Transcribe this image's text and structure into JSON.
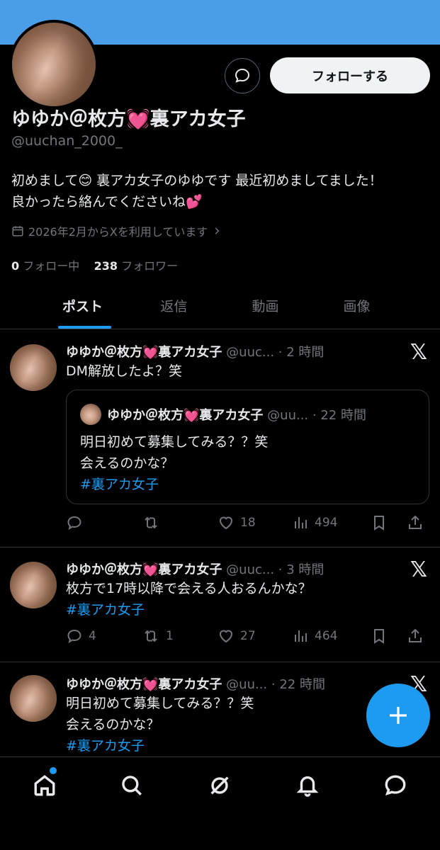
{
  "profile": {
    "display_name": "ゆゆか＠枚方💓裏アカ女子",
    "handle": "@uuchan_2000_",
    "bio_line1": "初めまして😊 裏アカ女子のゆゆです 最近初めましてました！",
    "bio_line2": "良かったら絡んでくださいね💕",
    "joined": "2026年2月からXを利用しています",
    "following_count": "0",
    "following_label": "フォロー中",
    "followers_count": "238",
    "followers_label": "フォロワー",
    "follow_button": "フォローする"
  },
  "tabs": [
    {
      "label": "ポスト",
      "active": true
    },
    {
      "label": "返信",
      "active": false
    },
    {
      "label": "動画",
      "active": false
    },
    {
      "label": "画像",
      "active": false
    }
  ],
  "posts": [
    {
      "name": "ゆゆか＠枚方💓裏アカ女子",
      "handle": "@uuc...",
      "time": "2 時間",
      "text": "DM解放したよ？笑",
      "quote": {
        "name": "ゆゆか＠枚方💓裏アカ女子",
        "handle": "@uu...",
        "time": "22 時間",
        "line1": "明日初めて募集してみる？？笑",
        "line2": "会えるのかな？",
        "hashtag": "#裏アカ女子"
      },
      "replies": "",
      "reposts": "",
      "likes": "18",
      "views": "494"
    },
    {
      "name": "ゆゆか＠枚方💓裏アカ女子",
      "handle": "@uuc...",
      "time": "3 時間",
      "line1": "枚方で17時以降で会える人おるんかな？",
      "hashtag": "#裏アカ女子",
      "replies": "4",
      "reposts": "1",
      "likes": "27",
      "views": "464"
    },
    {
      "name": "ゆゆか＠枚方💓裏アカ女子",
      "handle": "@uu...",
      "time": "22 時間",
      "line1": "明日初めて募集してみる？？笑",
      "line2": "会えるのかな？",
      "hashtag": "#裏アカ女子"
    }
  ],
  "icons": {
    "x_logo": "𝕏"
  }
}
